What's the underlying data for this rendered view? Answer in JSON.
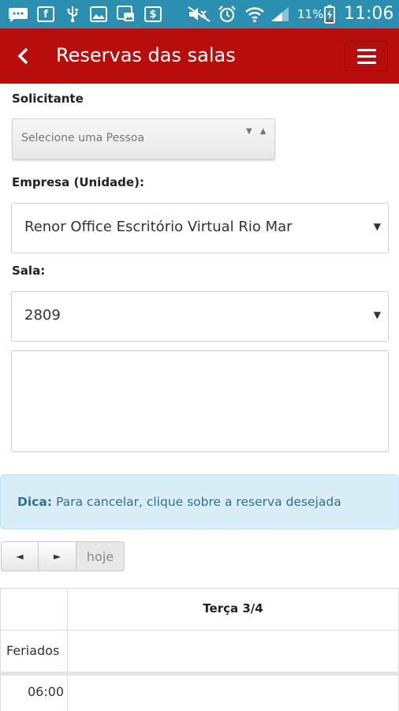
{
  "status_bar": {
    "battery_percent": "11%",
    "time": "11:06",
    "left_icons": [
      "message-icon",
      "facebook-icon",
      "usb-icon",
      "image-icon",
      "photo-icon",
      "payment-app-icon"
    ],
    "right_icons": [
      "mute-icon",
      "alarm-icon",
      "wifi-icon",
      "signal-icon",
      "battery-charging-icon"
    ]
  },
  "appbar": {
    "title": "Reservas das salas",
    "color": "#b80d0d"
  },
  "form": {
    "requester_label": "Solicitante",
    "requester_placeholder": "Selecione uma Pessoa",
    "company_label": "Empresa (Unidade):",
    "company_value": "Renor Office Escritório Virtual Rio Mar",
    "room_label": "Sala:",
    "room_value": "2809",
    "notes_value": ""
  },
  "tip": {
    "prefix": "Dica:",
    "text": "Para cancelar, clique sobre a reserva desejada"
  },
  "calendar": {
    "prev_symbol": "◄",
    "next_symbol": "►",
    "today_label": "hoje",
    "day_header": "Terça 3/4",
    "allday_label": "Feriados",
    "first_time": "06:00"
  }
}
